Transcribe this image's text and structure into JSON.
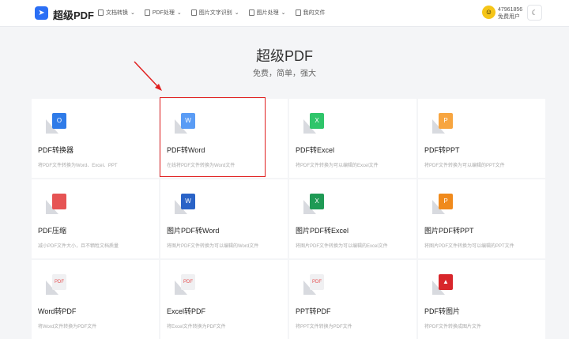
{
  "header": {
    "brand": "超级PDF",
    "nav": [
      "文档转换",
      "PDF处理",
      "图片文字识别",
      "图片处理",
      "我的文件"
    ],
    "user_id": "47961856",
    "user_tier": "免费用户"
  },
  "hero": {
    "title": "超级PDF",
    "subtitle": "免费，简单，强大"
  },
  "tools": [
    {
      "title": "PDF转换器",
      "desc": "将PDF文件转换为Word、Excel、PPT",
      "glyph": "O",
      "color": "#2f7be8"
    },
    {
      "title": "PDF转Word",
      "desc": "在线将PDF文件转换为Word文件",
      "glyph": "W",
      "color": "#5a9cf5"
    },
    {
      "title": "PDF转Excel",
      "desc": "将PDF文件转换为可以编辑的Excel文件",
      "glyph": "X",
      "color": "#2fc56a"
    },
    {
      "title": "PDF转PPT",
      "desc": "将PDF文件转换为可以编辑的PPT文件",
      "glyph": "P",
      "color": "#f7a540"
    },
    {
      "title": "PDF压缩",
      "desc": "减小PDF文件大小，且不牺牲文档质量",
      "glyph": "",
      "color": "#e65454"
    },
    {
      "title": "图片PDF转Word",
      "desc": "将图片PDF文件转换为可以编辑的Word文件",
      "glyph": "W",
      "color": "#2a63c7"
    },
    {
      "title": "图片PDF转Excel",
      "desc": "将图片PDF文件转换为可以编辑的Excel文件",
      "glyph": "X",
      "color": "#1f9a55"
    },
    {
      "title": "图片PDF转PPT",
      "desc": "将图片PDF文件转换为可以编辑的PPT文件",
      "glyph": "P",
      "color": "#f08a1c"
    },
    {
      "title": "Word转PDF",
      "desc": "将Word文件转换为PDF文件",
      "glyph": "PDF",
      "color": "#f0f0f2"
    },
    {
      "title": "Excel转PDF",
      "desc": "将Excel文件转换为PDF文件",
      "glyph": "PDF",
      "color": "#f0f0f2"
    },
    {
      "title": "PPT转PDF",
      "desc": "将PPT文件转换为PDF文件",
      "glyph": "PDF",
      "color": "#f0f0f2"
    },
    {
      "title": "PDF转图片",
      "desc": "将PDF文件转换成图片文件",
      "glyph": "▲",
      "color": "#d8262b"
    }
  ]
}
